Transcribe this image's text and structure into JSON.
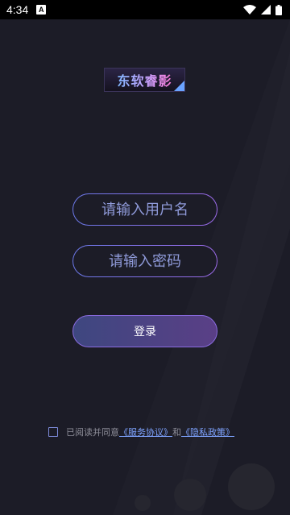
{
  "status_bar": {
    "time": "4:34",
    "notification_badge": "A",
    "icons": [
      "wifi-icon",
      "signal-icon",
      "battery-icon"
    ]
  },
  "logo": {
    "text": "东软睿影"
  },
  "login_form": {
    "username_placeholder": "请输入用户名",
    "password_placeholder": "请输入密码",
    "login_label": "登录"
  },
  "agreement": {
    "prefix": "已阅读并同意",
    "service_link": "《服务协议》",
    "and": "和",
    "privacy_link": "《隐私政策》"
  },
  "colors": {
    "background": "#1c1c27",
    "accent": "#8a6be0",
    "link": "#7ea3ff"
  }
}
